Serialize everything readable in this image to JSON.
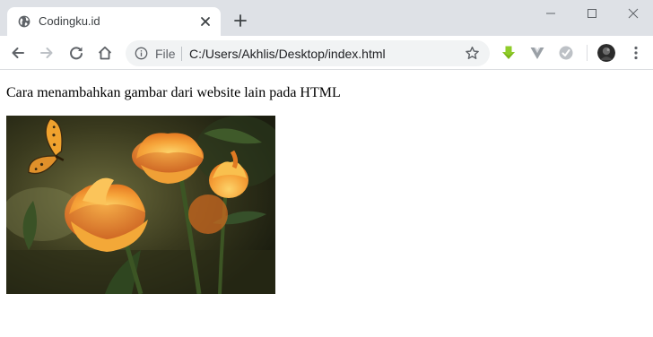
{
  "tab": {
    "title": "Codingku.id",
    "favicon": "globe-icon",
    "close_icon": "close-icon"
  },
  "new_tab_icon": "plus-icon",
  "window_controls": [
    "minimize-icon",
    "maximize-icon",
    "close-icon"
  ],
  "toolbar": {
    "back_icon": "arrow-left-icon",
    "forward_icon": "arrow-right-icon",
    "reload_icon": "reload-icon",
    "home_icon": "home-icon",
    "omnibox": {
      "info_icon": "info-icon",
      "scheme_label": "File",
      "url": "C:/Users/Akhlis/Desktop/index.html",
      "bookmark_icon": "star-icon"
    },
    "extensions": [
      "download-extension-icon",
      "vue-devtools-icon",
      "grammarly-icon"
    ],
    "menu_icon": "kebab-menu-icon"
  },
  "page": {
    "text": "Cara menambahkan gambar dari website lain pada HTML",
    "image": "butterfly-and-orange-flowers-photo"
  },
  "colors": {
    "tabstrip": "#dee1e6",
    "omnibox": "#f1f3f4",
    "extension_green": "#7cb518",
    "icon_grey": "#5f6368"
  }
}
